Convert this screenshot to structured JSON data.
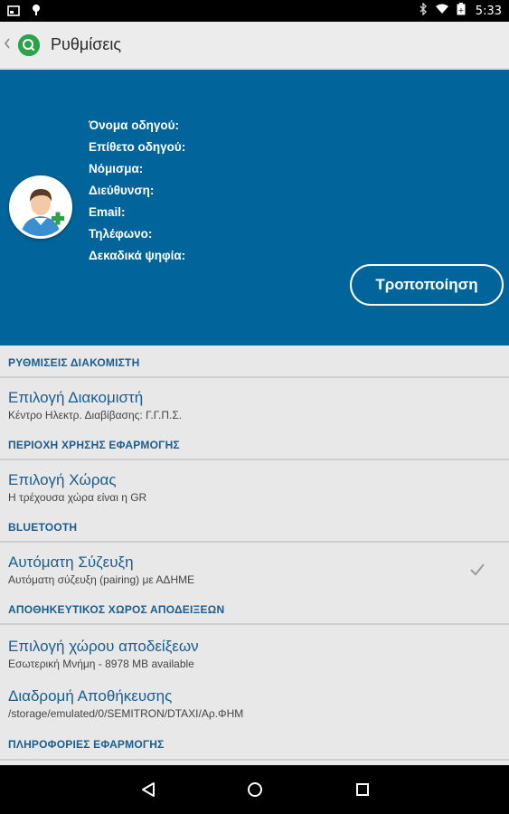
{
  "status_bar": {
    "time": "5:33",
    "icons": [
      "screenshot-icon",
      "notification-icon",
      "bluetooth-icon",
      "wifi-icon",
      "battery-icon"
    ]
  },
  "app_bar": {
    "title": "Ρυθμίσεις",
    "logo_color": "#2ca24b"
  },
  "profile": {
    "fields": [
      "Όνομα οδηγού:",
      "Επίθετο οδηγού:",
      "Νόμισμα:",
      "Διεύθυνση:",
      "Email:",
      "Τηλέφωνο:",
      "Δεκαδικά ψηφία:"
    ],
    "edit_button": "Τροποποίηση",
    "background": "#01649a"
  },
  "sections": [
    {
      "header": "ΡΥΘΜΙΣΕΙΣ ΔΙΑΚΟΜΙΣΤΗ",
      "items": [
        {
          "title": "Επιλογή Διακομιστή",
          "summary": "Κέντρο Ηλεκτρ. Διαβίβασης: Γ.Γ.Π.Σ."
        }
      ]
    },
    {
      "header": "ΠΕΡΙΟΧΗ ΧΡΗΣΗΣ ΕΦΑΡΜΟΓΗΣ",
      "items": [
        {
          "title": "Επιλογή Χώρας",
          "summary": "Η τρέχουσα χώρα είναι η GR"
        }
      ]
    },
    {
      "header": "BLUETOOTH",
      "items": [
        {
          "title": "Αυτόματη Σύζευξη",
          "summary": "Αυτόματη σύζευξη (pairing) με ΑΔΗΜΕ",
          "checked": true
        }
      ]
    },
    {
      "header": "ΑΠΟΘΗΚΕΥΤΙΚΟΣ ΧΩΡΟΣ ΑΠΟΔΕΙΞΕΩΝ",
      "items": [
        {
          "title": "Επιλογή χώρου αποδείξεων",
          "summary": "Εσωτερική Μνήμη - 8978 MB available"
        },
        {
          "title": "Διαδρομή Αποθήκευσης",
          "summary": "/storage/emulated/0/SEMITRON/DTAXI/Αρ.ΦΗΜ"
        }
      ]
    },
    {
      "header": "ΠΛΗΡΟΦΟΡΙΕΣ ΕΦΑΡΜΟΓΗΣ",
      "items": []
    }
  ],
  "nav_bar": {
    "buttons": [
      "back-icon",
      "home-icon",
      "recents-icon"
    ]
  }
}
